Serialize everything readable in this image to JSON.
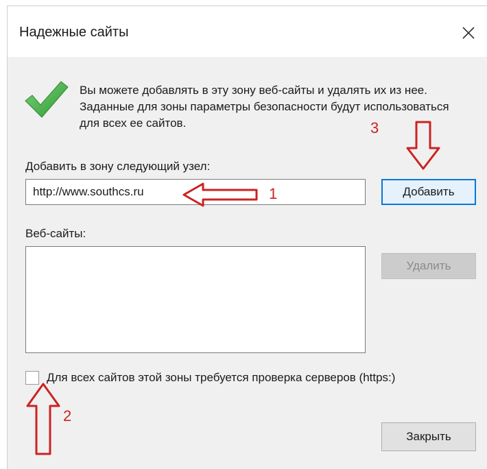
{
  "dialog": {
    "title": "Надежные сайты",
    "description": "Вы можете добавлять в эту зону  веб-сайты и удалять их из нее. Заданные для зоны параметры безопасности будут использоваться для всех ее сайтов.",
    "add_label": "Добавить в зону следующий узел:",
    "url_value": "http://www.southcs.ru",
    "add_button": "Добавить",
    "websites_label": "Веб-сайты:",
    "websites": [],
    "remove_button": "Удалить",
    "https_checkbox_label": "Для всех сайтов этой зоны требуется проверка серверов (https:)",
    "https_checked": false,
    "close_button": "Закрыть"
  },
  "annotations": {
    "step1": "1",
    "step2": "2",
    "step3": "3",
    "color": "#cc2222"
  },
  "icons": {
    "close": "close-icon",
    "check": "green-checkmark-icon"
  },
  "colors": {
    "accent": "#0078d7",
    "dialog_bg": "#f0f0f0",
    "check_green": "#3da83f"
  }
}
